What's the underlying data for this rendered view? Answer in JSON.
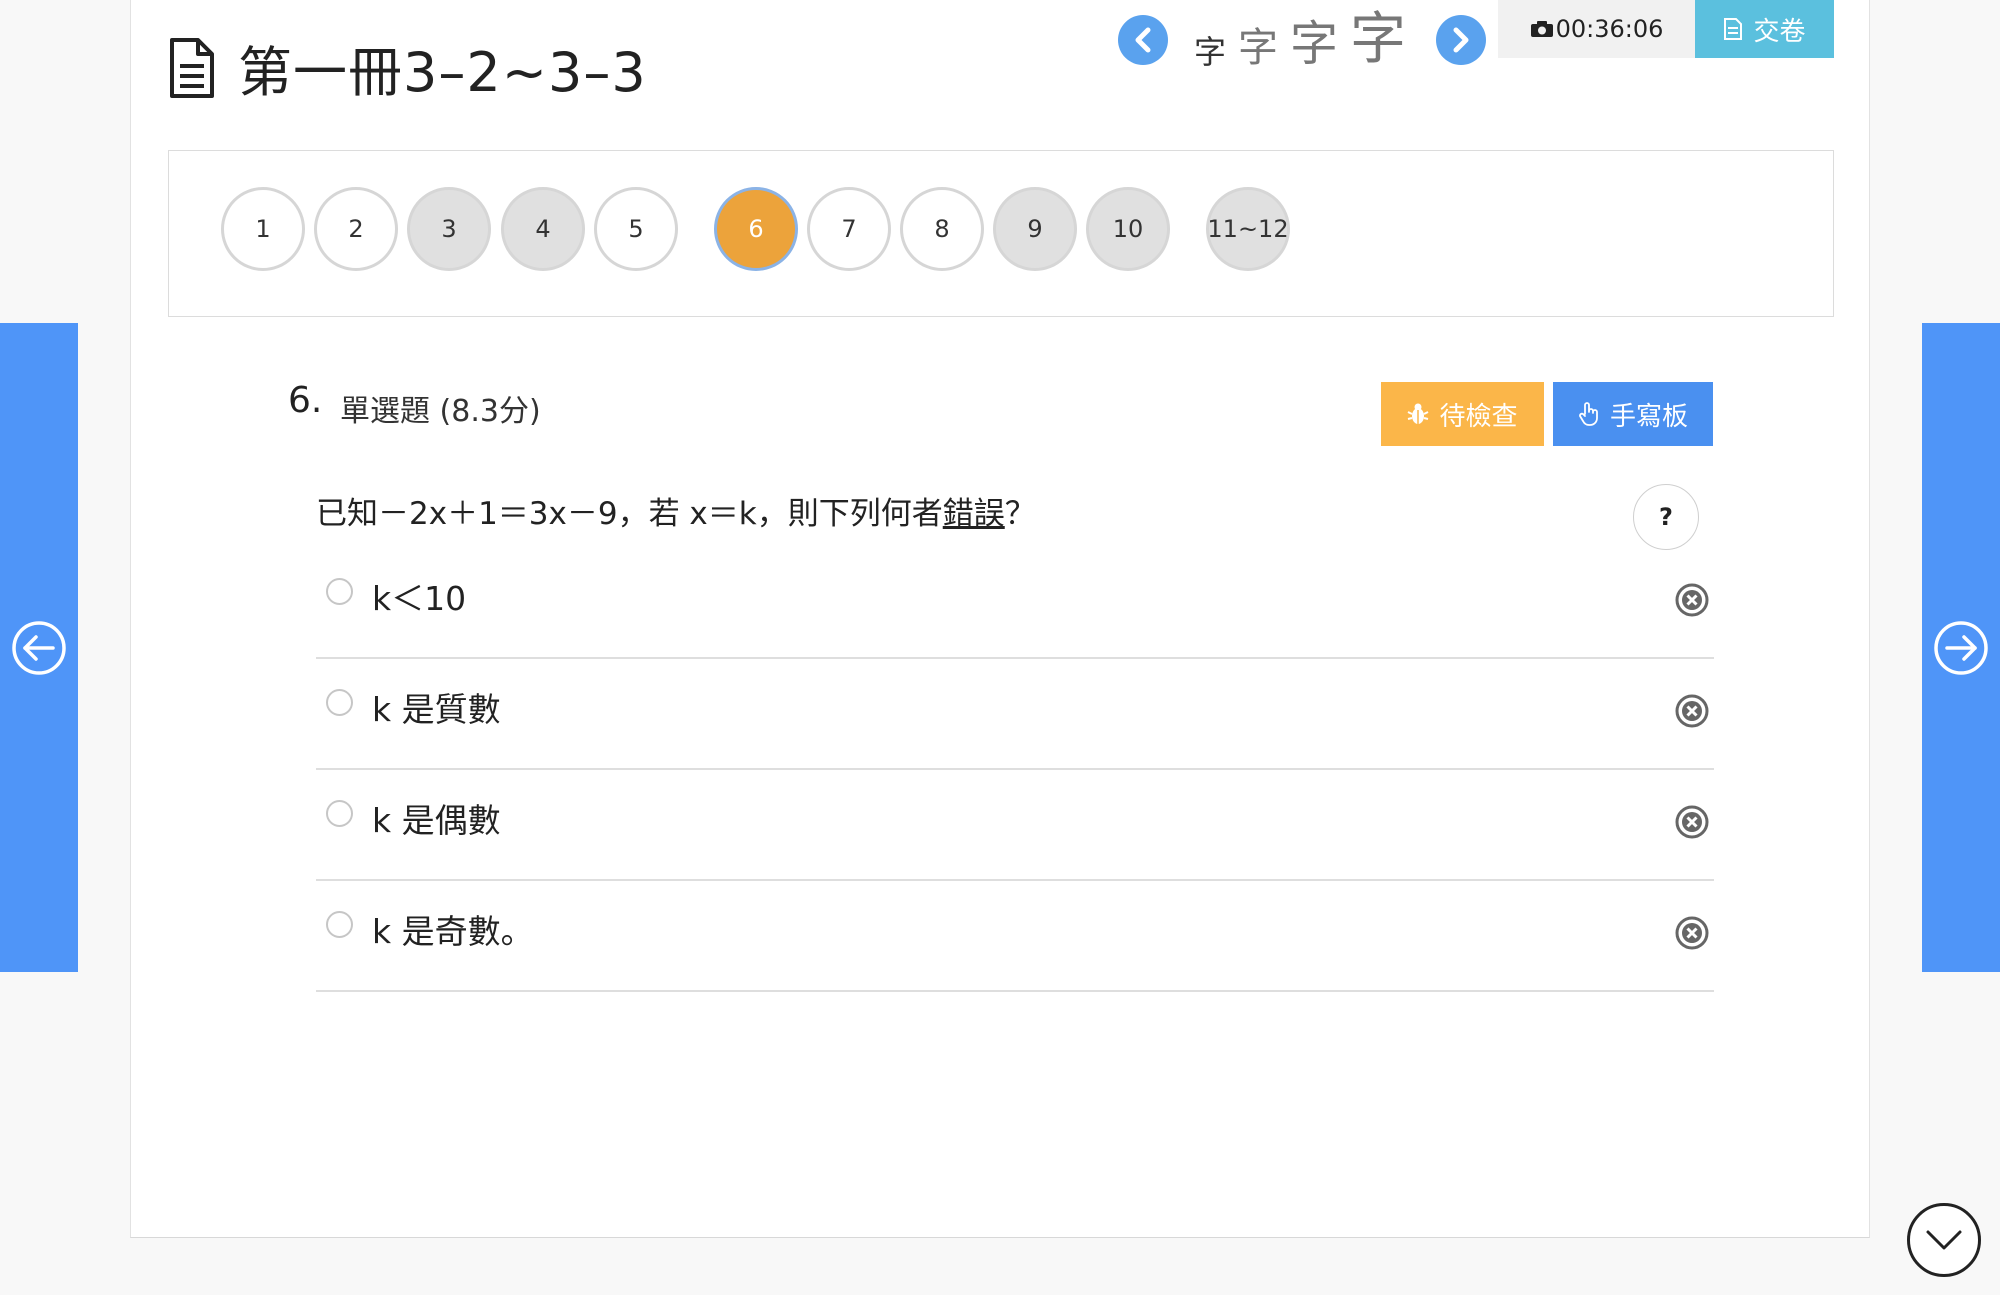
{
  "header": {
    "title": "第一冊3–2~3–3",
    "font_size_glyphs": [
      "字",
      "字",
      "字",
      "字"
    ],
    "timer": "00:36:06",
    "submit_label": "交卷"
  },
  "question_nav": {
    "items": [
      {
        "label": "1",
        "state": "unanswered"
      },
      {
        "label": "2",
        "state": "unanswered"
      },
      {
        "label": "3",
        "state": "answered"
      },
      {
        "label": "4",
        "state": "answered"
      },
      {
        "label": "5",
        "state": "unanswered"
      },
      {
        "label": "6",
        "state": "current"
      },
      {
        "label": "7",
        "state": "unanswered"
      },
      {
        "label": "8",
        "state": "unanswered"
      },
      {
        "label": "9",
        "state": "answered"
      },
      {
        "label": "10",
        "state": "answered"
      },
      {
        "label": "11~12",
        "state": "answered"
      }
    ]
  },
  "question": {
    "number": "6.",
    "type": "單選題 (8.3分)",
    "pending_label": "待檢查",
    "handwrite_label": "手寫板",
    "stem_before": "已知－2x＋1＝3x－9，若 x＝k，則下列何者",
    "stem_emphasis": "錯誤",
    "stem_after": "？",
    "help_label": "?",
    "options": [
      {
        "text": "k＜10"
      },
      {
        "text": "k 是質數"
      },
      {
        "text": "k 是偶數"
      },
      {
        "text": "k 是奇數。"
      }
    ]
  },
  "colors": {
    "accent_blue": "#4f95f8",
    "current_orange": "#eca33b",
    "pending_orange": "#fbb649",
    "submit_cyan": "#5bc0de"
  },
  "icons": {
    "doc": "document-icon",
    "prev": "chevron-left-icon",
    "next": "chevron-right-icon",
    "timer": "camera-icon",
    "submit": "paper-icon",
    "pending": "bug-icon",
    "handwrite": "hand-pointer-icon",
    "eliminate": "close-circle-icon",
    "side_prev": "arrow-left-circle-icon",
    "side_next": "arrow-right-circle-icon",
    "scroll": "chevron-down-icon"
  }
}
